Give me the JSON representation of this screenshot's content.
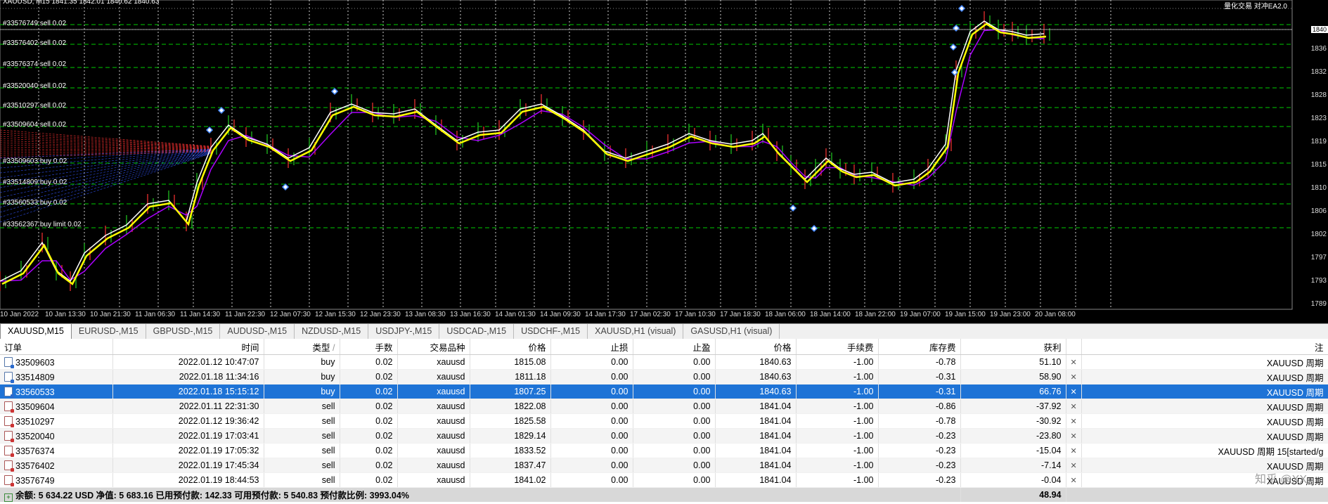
{
  "chart": {
    "header_info": "XAUUSD, M15  1841.35 1842.01 1840.62 1840.63",
    "top_right_info": "量化交易 对冲EA2.0",
    "current_price_tag": "1840",
    "order_lines": [
      {
        "label": "#33576749 sell 0.02"
      },
      {
        "label": "#33576402 sell 0.02"
      },
      {
        "label": "#33576374 sell 0.02"
      },
      {
        "label": "#33520040 sell 0.02"
      },
      {
        "label": "#33510297 sell 0.02"
      },
      {
        "label": "#33509604 sell 0.02"
      },
      {
        "label": "#33509603 buy 0.02"
      },
      {
        "label": "#33514809 buy 0.02"
      },
      {
        "label": "#33560533 buy 0.02"
      },
      {
        "label": "#33562367 buy limit 0.02"
      }
    ],
    "price_ticks": [
      "1836",
      "1832",
      "1828",
      "1823",
      "1819",
      "1815",
      "1810",
      "1806",
      "1802",
      "1797",
      "1793",
      "1789"
    ],
    "time_ticks": [
      "10 Jan 2022",
      "10 Jan 13:30",
      "10 Jan 21:30",
      "11 Jan 06:30",
      "11 Jan 14:30",
      "11 Jan 22:30",
      "12 Jan 07:30",
      "12 Jan 15:30",
      "12 Jan 23:30",
      "13 Jan 08:30",
      "13 Jan 16:30",
      "14 Jan 01:30",
      "14 Jan 09:30",
      "14 Jan 17:30",
      "17 Jan 02:30",
      "17 Jan 10:30",
      "17 Jan 18:30",
      "18 Jan 06:00",
      "18 Jan 14:00",
      "18 Jan 22:00",
      "19 Jan 07:00",
      "19 Jan 15:00",
      "19 Jan 23:00",
      "20 Jan 08:00"
    ],
    "colors": {
      "background": "#000000",
      "grid": "#ffffff",
      "order_line": "#00cc00",
      "sell_line": "#ff3333",
      "buy_line": "#3355ff",
      "ma_fast": "#ffff00",
      "ma_mid": "#ffffff",
      "ma_slow": "#aa00ff",
      "marker": "#4488ff"
    }
  },
  "tabs": [
    {
      "label": "XAUUSD,M15",
      "active": true
    },
    {
      "label": "EURUSD-,M15"
    },
    {
      "label": "GBPUSD-,M15"
    },
    {
      "label": "AUDUSD-,M15"
    },
    {
      "label": "NZDUSD-,M15"
    },
    {
      "label": "USDJPY-,M15"
    },
    {
      "label": "USDCAD-,M15"
    },
    {
      "label": "USDCHF-,M15"
    },
    {
      "label": "XAUUSD,H1 (visual)"
    },
    {
      "label": "GASUSD,H1 (visual)"
    }
  ],
  "table": {
    "headers": {
      "order": "订单",
      "time": "时间",
      "type": "类型",
      "sort_marker": "/",
      "lots": "手数",
      "symbol": "交易品种",
      "price": "价格",
      "sl": "止损",
      "tp": "止盈",
      "cur_price": "价格",
      "commission": "手续费",
      "swap": "库存费",
      "profit": "获利",
      "comment": "注"
    },
    "rows": [
      {
        "order": "33509603",
        "time": "2022.01.12 10:47:07",
        "type": "buy",
        "lots": "0.02",
        "symbol": "xauusd",
        "price": "1815.08",
        "sl": "0.00",
        "tp": "0.00",
        "cur_price": "1840.63",
        "commission": "-1.00",
        "swap": "-0.78",
        "profit": "51.10",
        "comment": "XAUUSD 周期"
      },
      {
        "order": "33514809",
        "time": "2022.01.18 11:34:16",
        "type": "buy",
        "lots": "0.02",
        "symbol": "xauusd",
        "price": "1811.18",
        "sl": "0.00",
        "tp": "0.00",
        "cur_price": "1840.63",
        "commission": "-1.00",
        "swap": "-0.31",
        "profit": "58.90",
        "comment": "XAUUSD 周期"
      },
      {
        "order": "33560533",
        "time": "2022.01.18 15:15:12",
        "type": "buy",
        "lots": "0.02",
        "symbol": "xauusd",
        "price": "1807.25",
        "sl": "0.00",
        "tp": "0.00",
        "cur_price": "1840.63",
        "commission": "-1.00",
        "swap": "-0.31",
        "profit": "66.76",
        "comment": "XAUUSD 周期",
        "selected": true
      },
      {
        "order": "33509604",
        "time": "2022.01.11 22:31:30",
        "type": "sell",
        "lots": "0.02",
        "symbol": "xauusd",
        "price": "1822.08",
        "sl": "0.00",
        "tp": "0.00",
        "cur_price": "1841.04",
        "commission": "-1.00",
        "swap": "-0.86",
        "profit": "-37.92",
        "comment": "XAUUSD 周期"
      },
      {
        "order": "33510297",
        "time": "2022.01.12 19:36:42",
        "type": "sell",
        "lots": "0.02",
        "symbol": "xauusd",
        "price": "1825.58",
        "sl": "0.00",
        "tp": "0.00",
        "cur_price": "1841.04",
        "commission": "-1.00",
        "swap": "-0.78",
        "profit": "-30.92",
        "comment": "XAUUSD 周期"
      },
      {
        "order": "33520040",
        "time": "2022.01.19 17:03:41",
        "type": "sell",
        "lots": "0.02",
        "symbol": "xauusd",
        "price": "1829.14",
        "sl": "0.00",
        "tp": "0.00",
        "cur_price": "1841.04",
        "commission": "-1.00",
        "swap": "-0.23",
        "profit": "-23.80",
        "comment": "XAUUSD 周期"
      },
      {
        "order": "33576374",
        "time": "2022.01.19 17:05:32",
        "type": "sell",
        "lots": "0.02",
        "symbol": "xauusd",
        "price": "1833.52",
        "sl": "0.00",
        "tp": "0.00",
        "cur_price": "1841.04",
        "commission": "-1.00",
        "swap": "-0.23",
        "profit": "-15.04",
        "comment": "XAUUSD 周期 15[started/g"
      },
      {
        "order": "33576402",
        "time": "2022.01.19 17:45:34",
        "type": "sell",
        "lots": "0.02",
        "symbol": "xauusd",
        "price": "1837.47",
        "sl": "0.00",
        "tp": "0.00",
        "cur_price": "1841.04",
        "commission": "-1.00",
        "swap": "-0.23",
        "profit": "-7.14",
        "comment": "XAUUSD 周期"
      },
      {
        "order": "33576749",
        "time": "2022.01.19 18:44:53",
        "type": "sell",
        "lots": "0.02",
        "symbol": "xauusd",
        "price": "1841.02",
        "sl": "0.00",
        "tp": "0.00",
        "cur_price": "1841.04",
        "commission": "-1.00",
        "swap": "-0.23",
        "profit": "-0.04",
        "comment": "XAUUSD 周期"
      }
    ],
    "summary": {
      "text": "余额: 5 634.22 USD  净值: 5 683.16  已用预付款: 142.33  可用预付款: 5 540.83  预付款比例: 3993.04%",
      "profit": "48.94"
    },
    "close_glyph": "✕"
  },
  "watermark": "知乎 @XX"
}
